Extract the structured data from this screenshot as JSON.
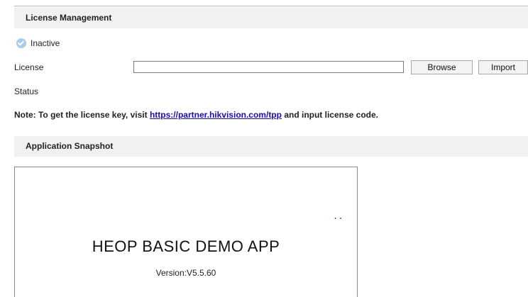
{
  "license_management": {
    "title": "License Management",
    "state_text": "Inactive",
    "license_label": "License",
    "license_value": "",
    "browse_label": "Browse",
    "import_label": "Import",
    "status_label": "Status",
    "note_prefix": "Note: To get the license key, visit ",
    "note_link": "https://partner.hikvision.com/tpp",
    "note_suffix": " and input license code."
  },
  "application_snapshot": {
    "title": "Application Snapshot",
    "dots": "..",
    "app_name": "HEOP BASIC DEMO APP",
    "version": "Version:V5.5.60"
  },
  "colors": {
    "header_bg": "#f1f1f1",
    "link": "#1a0dab",
    "status_icon": "#a9cdea"
  }
}
